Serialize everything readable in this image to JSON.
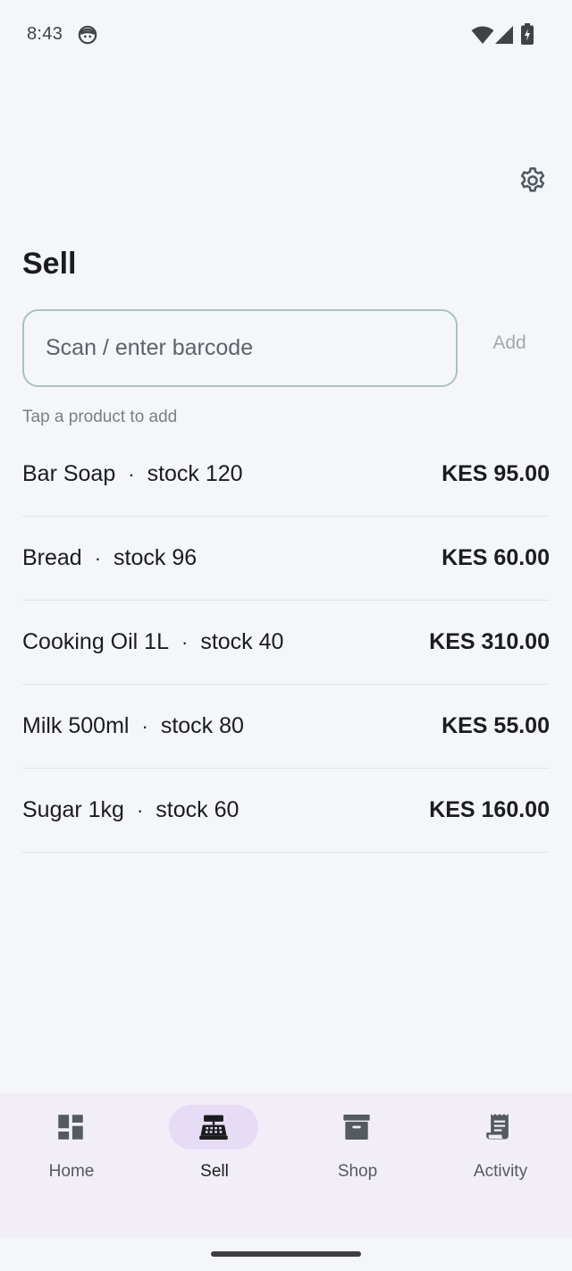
{
  "status_bar": {
    "time": "8:43"
  },
  "header": {
    "title": "Sell"
  },
  "barcode": {
    "placeholder": "Scan / enter barcode",
    "value": "",
    "add_label": "Add"
  },
  "hint": "Tap a product to add",
  "products": [
    {
      "name": "Bar Soap",
      "stock": "stock 120",
      "price": "KES 95.00"
    },
    {
      "name": "Bread",
      "stock": "stock 96",
      "price": "KES 60.00"
    },
    {
      "name": "Cooking Oil 1L",
      "stock": "stock 40",
      "price": "KES 310.00"
    },
    {
      "name": "Milk 500ml",
      "stock": "stock 80",
      "price": "KES 55.00"
    },
    {
      "name": "Sugar 1kg",
      "stock": "stock 60",
      "price": "KES 160.00"
    }
  ],
  "separator": "·",
  "nav": [
    {
      "label": "Home",
      "icon": "dashboard-icon",
      "active": false
    },
    {
      "label": "Sell",
      "icon": "cash-register-icon",
      "active": true
    },
    {
      "label": "Shop",
      "icon": "archive-box-icon",
      "active": false
    },
    {
      "label": "Activity",
      "icon": "receipt-icon",
      "active": false
    }
  ],
  "colors": {
    "background": "#f5f6f9",
    "field_border": "#a8c4bc",
    "nav_background": "#f2eef7",
    "nav_active_pill": "#e7dcf5",
    "icon": "#545a60"
  }
}
